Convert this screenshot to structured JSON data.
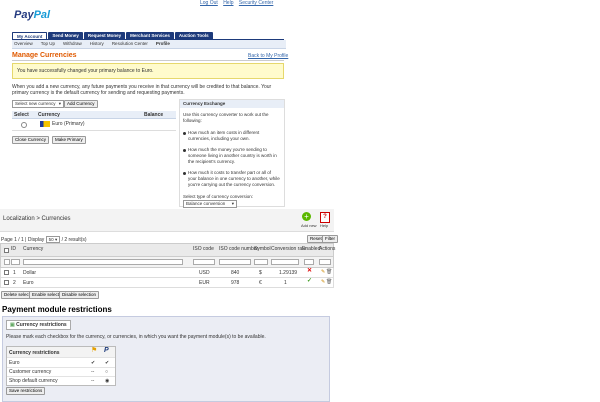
{
  "paypal": {
    "logo_pay": "Pay",
    "logo_pal": "Pal",
    "toplinks": [
      "Log Out",
      "Help",
      "Security Center"
    ],
    "tabs": [
      "My Account",
      "Send Money",
      "Request Money",
      "Merchant Services",
      "Auction Tools"
    ],
    "subnav": [
      "Overview",
      "Top Up",
      "Withdraw",
      "History",
      "Resolution Center",
      "Profile"
    ],
    "title": "Manage Currencies",
    "back_link": "Back to My Profile",
    "notice": "You have successfully changed your primary balance to Euro.",
    "description": "When you add a new currency, any future payments you receive in that currency will be credited to that balance. Your primary currency is the default currency for sending and requesting payments.",
    "select_placeholder": "Select new currency",
    "add_currency_btn": "Add Currency",
    "table_headers": [
      "Select",
      "Currency",
      "Balance"
    ],
    "currency_row": "Euro (Primary)",
    "close_currency_btn": "Close Currency",
    "make_primary_btn": "Make Primary",
    "exchange": {
      "title": "Currency Exchange",
      "intro": "Use this currency converter to work out the following:",
      "bullets": [
        "How much an item costs in different currencies, including your own.",
        "How much the money you're sending to someone living in another country is worth in the recipient's currency.",
        "How much it costs to transfer part or all of your balance in one currency to another, while you're carrying out the currency conversion."
      ],
      "select_label": "Select type of currency conversion:",
      "select_value": "Balance conversion"
    }
  },
  "localization": {
    "breadcrumb_1": "Localization",
    "breadcrumb_sep": ">",
    "breadcrumb_2": "Currencies",
    "add_new": "Add new",
    "help": "Help",
    "pagination": "Page 1 / 1 | Display",
    "per_page": "50",
    "result_count": "/ 2 result(s)",
    "reset_btn": "Reset",
    "filter_btn": "Filter",
    "columns": [
      "ID",
      "Currency",
      "ISO code",
      "ISO code number",
      "Symbol",
      "Conversion rate",
      "Enabled",
      "Actions"
    ],
    "rows": [
      {
        "id": "1",
        "currency": "Dollar",
        "iso": "USD",
        "iso_num": "840",
        "symbol": "$",
        "rate": "1.29139",
        "enabled": "✕"
      },
      {
        "id": "2",
        "currency": "Euro",
        "iso": "EUR",
        "iso_num": "978",
        "symbol": "€",
        "rate": "1",
        "enabled": "✓"
      }
    ],
    "bulk_buttons": [
      "Delete selected",
      "Enable selection",
      "Disable selection"
    ]
  },
  "payment": {
    "title": "Payment module restrictions",
    "legend": "Currency restrictions",
    "description": "Please mark each checkbox for the currency, or currencies, in which you want the payment module(s) to be available.",
    "table_header": "Currency restrictions",
    "rows": [
      {
        "label": "Euro",
        "c1": "✔",
        "c2": "✔"
      },
      {
        "label": "Customer currency",
        "c1": "--",
        "c2": "○"
      },
      {
        "label": "Shop default currency",
        "c1": "--",
        "c2": "◉"
      }
    ],
    "save_btn": "Save restrictions"
  }
}
